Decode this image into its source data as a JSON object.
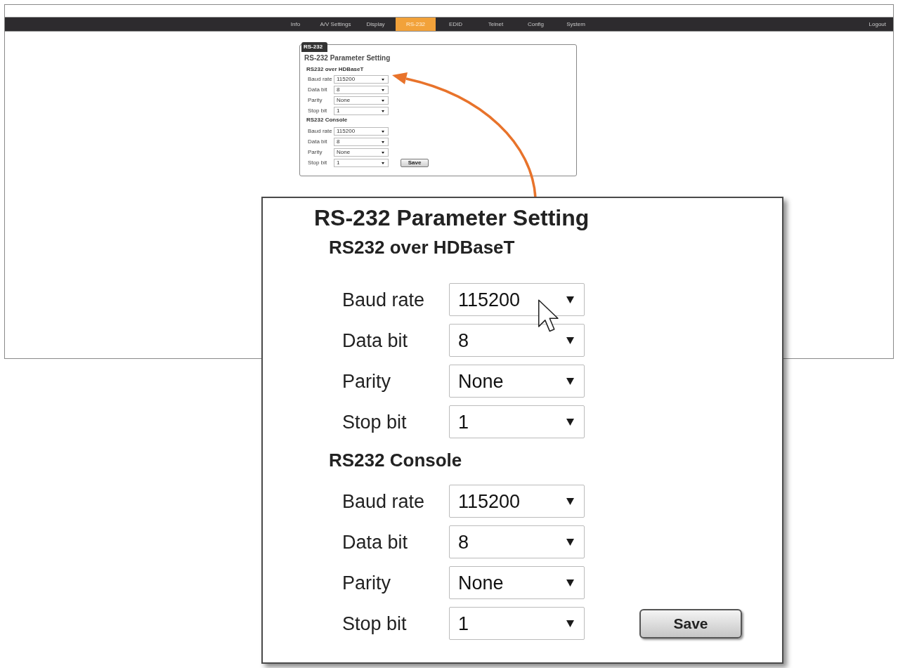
{
  "nav": {
    "tabs": [
      {
        "label": "Info",
        "selected": false
      },
      {
        "label": "A/V Settings",
        "selected": false
      },
      {
        "label": "Display",
        "selected": false
      },
      {
        "label": "RS-232",
        "selected": true
      },
      {
        "label": "EDID",
        "selected": false
      },
      {
        "label": "Telnet",
        "selected": false
      },
      {
        "label": "Config",
        "selected": false
      },
      {
        "label": "System",
        "selected": false
      }
    ],
    "logout": "Logout"
  },
  "panel": {
    "legend": "RS-232",
    "title": "RS-232 Parameter Setting",
    "groups": [
      {
        "title": "RS232 over HDBaseT",
        "fields": [
          {
            "label": "Baud rate",
            "value": "115200"
          },
          {
            "label": "Data bit",
            "value": "8"
          },
          {
            "label": "Parity",
            "value": "None"
          },
          {
            "label": "Stop bit",
            "value": "1"
          }
        ]
      },
      {
        "title": "RS232 Console",
        "fields": [
          {
            "label": "Baud rate",
            "value": "115200"
          },
          {
            "label": "Data bit",
            "value": "8"
          },
          {
            "label": "Parity",
            "value": "None"
          },
          {
            "label": "Stop bit",
            "value": "1"
          }
        ]
      }
    ],
    "save": "Save"
  },
  "callout": {
    "title": "RS-232 Parameter Setting",
    "groups": [
      {
        "title": "RS232 over HDBaseT",
        "fields": [
          {
            "label": "Baud rate",
            "value": "115200"
          },
          {
            "label": "Data bit",
            "value": "8"
          },
          {
            "label": "Parity",
            "value": "None"
          },
          {
            "label": "Stop bit",
            "value": "1"
          }
        ]
      },
      {
        "title": "RS232 Console",
        "fields": [
          {
            "label": "Baud rate",
            "value": "115200"
          },
          {
            "label": "Data bit",
            "value": "8"
          },
          {
            "label": "Parity",
            "value": "None"
          },
          {
            "label": "Stop bit",
            "value": "1"
          }
        ]
      }
    ],
    "save": "Save"
  }
}
